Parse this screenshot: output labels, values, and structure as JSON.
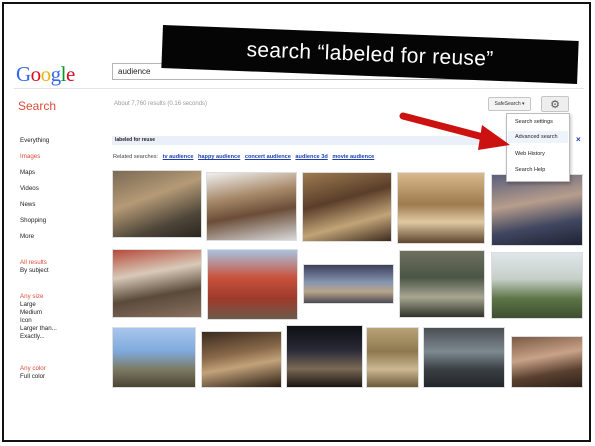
{
  "banner": {
    "text": "search “labeled for reuse”"
  },
  "header": {
    "logo": [
      "G",
      "o",
      "o",
      "g",
      "l",
      "e"
    ],
    "logo_colors": [
      "#3369e8",
      "#d50f25",
      "#eeb211",
      "#3369e8",
      "#009925",
      "#d50f25"
    ],
    "query": "audience"
  },
  "toolbar": {
    "section_title": "Search",
    "results_count": "About 7,760 results (0.16 seconds)",
    "safesearch_label": "SafeSearch ▾",
    "gear_glyph": "⚙"
  },
  "gear_menu": {
    "items": [
      "Search settings",
      "Advanced search",
      "Web History",
      "Search Help"
    ],
    "highlight_index": 1
  },
  "sidebar": {
    "items": [
      "Everything",
      "Images",
      "Maps",
      "Videos",
      "News",
      "Shopping",
      "More"
    ],
    "active_index": 1,
    "results_heading": "All results",
    "results_sub": "By subject",
    "size_heading": "Any size",
    "size_items": [
      "Large",
      "Medium",
      "Icon",
      "Larger than...",
      "Exactly..."
    ],
    "color_heading": "Any color",
    "color_items": [
      "Full color"
    ]
  },
  "filter": {
    "label": "labeled for reuse",
    "close_glyph": "×"
  },
  "related": {
    "prefix": "Related searches:",
    "links": [
      "tv audience",
      "happy audience",
      "concert audience",
      "audience 3d",
      "movie audience"
    ]
  },
  "colors": {
    "accent_red": "#dd4b39",
    "link_blue": "#1a3db3",
    "arrow_red": "#cc1111"
  }
}
